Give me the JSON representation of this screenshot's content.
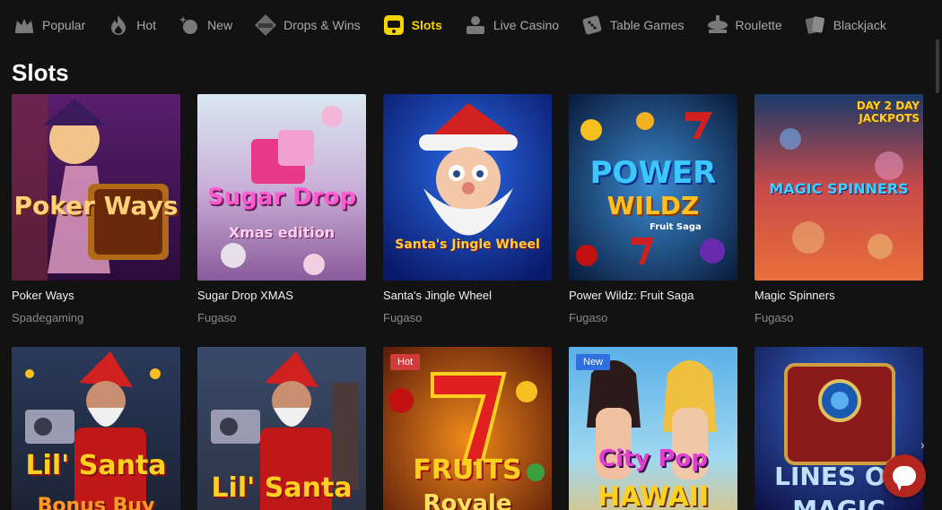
{
  "nav": {
    "items": [
      {
        "label": "Popular",
        "icon": "crown-icon",
        "active": false
      },
      {
        "label": "Hot",
        "icon": "flame-icon",
        "active": false
      },
      {
        "label": "New",
        "icon": "sparkle-icon",
        "active": false
      },
      {
        "label": "Drops & Wins",
        "icon": "drops-wins-icon",
        "active": false
      },
      {
        "label": "Slots",
        "icon": "slot-machine-icon",
        "active": true
      },
      {
        "label": "Live Casino",
        "icon": "live-dealer-icon",
        "active": false
      },
      {
        "label": "Table Games",
        "icon": "dice-icon",
        "active": false
      },
      {
        "label": "Roulette",
        "icon": "roulette-icon",
        "active": false
      },
      {
        "label": "Blackjack",
        "icon": "cards-icon",
        "active": false
      }
    ],
    "active_color": "#f5d400"
  },
  "section": {
    "title": "Slots"
  },
  "games": [
    {
      "title": "Poker Ways",
      "provider": "Spadegaming",
      "art_text": "Poker Ways",
      "badge": ""
    },
    {
      "title": "Sugar Drop XMAS",
      "provider": "Fugaso",
      "art_text": "Sugar Drop",
      "art_sub": "Xmas edition",
      "badge": ""
    },
    {
      "title": "Santa's Jingle Wheel",
      "provider": "Fugaso",
      "art_text": "Santa's Jingle Wheel",
      "badge": ""
    },
    {
      "title": "Power Wildz: Fruit Saga",
      "provider": "Fugaso",
      "art_text": "POWER",
      "art_sub": "WILDZ",
      "art_sub2": "Fruit Saga",
      "badge": ""
    },
    {
      "title": "Magic Spinners",
      "provider": "Fugaso",
      "art_text": "MAGIC SPINNERS",
      "art_sub": "DAY 2 DAY JACKPOTS",
      "badge": ""
    },
    {
      "title": "",
      "provider": "",
      "art_text": "Lil' Santa",
      "art_sub": "Bonus Buy",
      "badge": ""
    },
    {
      "title": "",
      "provider": "",
      "art_text": "Lil' Santa",
      "badge": ""
    },
    {
      "title": "",
      "provider": "",
      "art_text": "FRUITS",
      "art_sub": "Royale",
      "badge": "Hot"
    },
    {
      "title": "",
      "provider": "",
      "art_text": "City Pop",
      "art_sub": "HAWAII",
      "badge": "New"
    },
    {
      "title": "",
      "provider": "",
      "art_text": "LINES OF",
      "art_sub": "MAGIC",
      "badge": ""
    }
  ],
  "colors": {
    "background": "#121212",
    "badge_hot": "#d53a3a",
    "badge_new": "#2f6fe0",
    "chat": "#b3261e"
  }
}
